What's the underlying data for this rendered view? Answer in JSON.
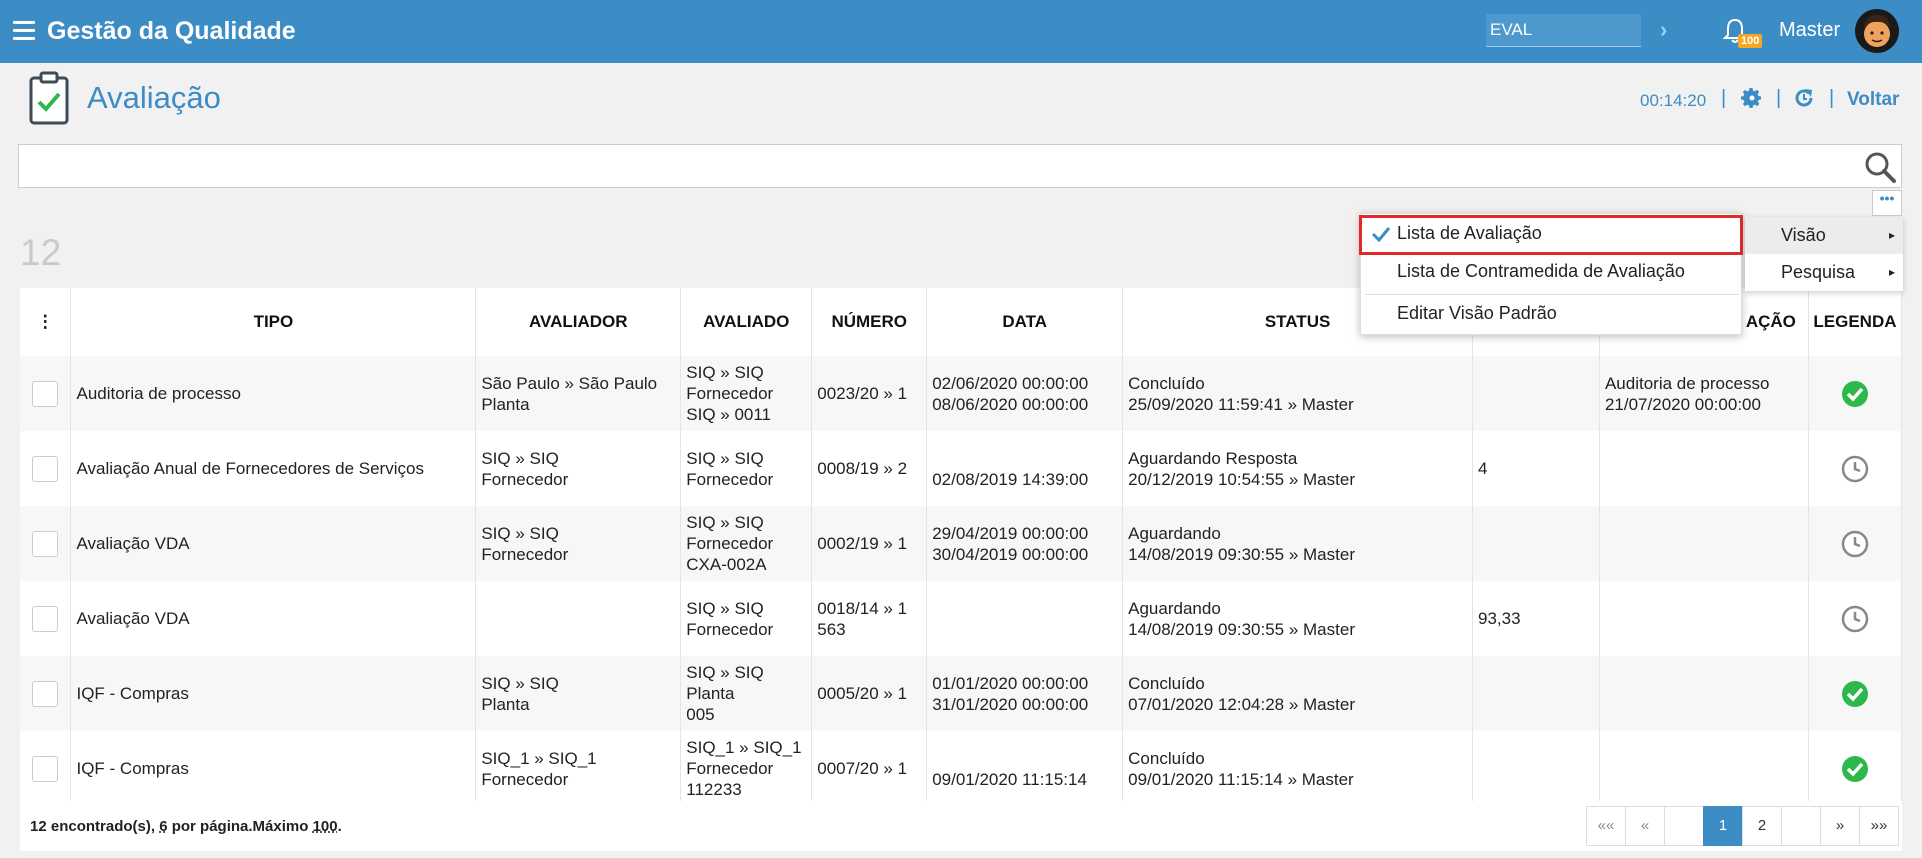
{
  "header": {
    "app_title": "Gestão da Qualidade",
    "module_input_value": "EVAL",
    "notification_count": "100",
    "user_name": "Master"
  },
  "page": {
    "title": "Avaliação",
    "timer": "00:14:20",
    "back_label": "Voltar",
    "search_placeholder": "",
    "record_count": "12"
  },
  "table": {
    "columns": [
      "TIPO",
      "AVALIADOR",
      "AVALIADO",
      "NÚMERO",
      "DATA",
      "STATUS",
      "",
      "AÇÃO",
      "LEGENDA"
    ],
    "rows": [
      {
        "tipo": "Auditoria de processo",
        "avaliador": "São Paulo » São Paulo\nPlanta",
        "avaliado": "SIQ » SIQ\nFornecedor\nSIQ » 0011",
        "numero": "0023/20 » 1",
        "data": "02/06/2020 00:00:00\n08/06/2020 00:00:00",
        "status": "Concluído\n25/09/2020 11:59:41 » Master",
        "nota": "",
        "acao": "Auditoria de processo\n21/07/2020 00:00:00",
        "legenda": "ok"
      },
      {
        "tipo": "Avaliação Anual de Fornecedores de Serviços",
        "avaliador": "SIQ » SIQ\nFornecedor",
        "avaliado": "SIQ » SIQ\nFornecedor",
        "numero": "0008/19 » 2",
        "data": "\n02/08/2019 14:39:00",
        "status": "Aguardando Resposta\n20/12/2019 10:54:55 » Master",
        "nota": "4",
        "acao": "",
        "legenda": "pending"
      },
      {
        "tipo": "Avaliação VDA",
        "avaliador": "SIQ » SIQ\nFornecedor",
        "avaliado": "SIQ » SIQ\nFornecedor\nCXA-002A",
        "numero": "0002/19 » 1",
        "data": "29/04/2019 00:00:00\n30/04/2019 00:00:00",
        "status": "Aguardando\n14/08/2019 09:30:55 » Master",
        "nota": "",
        "acao": "",
        "legenda": "pending"
      },
      {
        "tipo": "Avaliação VDA",
        "avaliador": "",
        "avaliado": "SIQ » SIQ\nFornecedor",
        "numero": "0018/14 » 1\n563",
        "data": "",
        "status": "Aguardando\n14/08/2019 09:30:55 » Master",
        "nota": "93,33",
        "acao": "",
        "legenda": "pending"
      },
      {
        "tipo": "IQF - Compras",
        "avaliador": "SIQ » SIQ\nPlanta",
        "avaliado": "SIQ » SIQ\nPlanta\n005",
        "numero": "0005/20 » 1",
        "data": "01/01/2020 00:00:00\n31/01/2020 00:00:00",
        "status": "Concluído\n07/01/2020 12:04:28 » Master",
        "nota": "",
        "acao": "",
        "legenda": "ok"
      },
      {
        "tipo": "IQF - Compras",
        "avaliador": "SIQ_1 » SIQ_1\nFornecedor",
        "avaliado": "SIQ_1 » SIQ_1\nFornecedor\n112233",
        "numero": "0007/20 » 1",
        "data": "\n09/01/2020 11:15:14",
        "status": "Concluído\n09/01/2020 11:15:14 » Master",
        "nota": "",
        "acao": "",
        "legenda": "ok"
      }
    ]
  },
  "footer": {
    "found_count": "12",
    "found_label": " encontrado(s), ",
    "per_page": "6",
    "per_page_label": " por página.Máximo ",
    "max": "100",
    "max_suffix": "."
  },
  "pager": {
    "first": "««",
    "prev": "«",
    "pages": [
      "1",
      "2"
    ],
    "current_page": "1",
    "next": "»",
    "last": "»»"
  },
  "menu": {
    "items": [
      "Lista de Avaliação",
      "Lista de Contramedida de Avaliação",
      "Editar Visão Padrão"
    ],
    "selected": "Lista de Avaliação",
    "side_items": [
      "Visão",
      "Pesquisa"
    ]
  },
  "colors": {
    "primary": "#3c8dc5",
    "ok": "#2db84b",
    "highlight": "#e02a2a"
  }
}
